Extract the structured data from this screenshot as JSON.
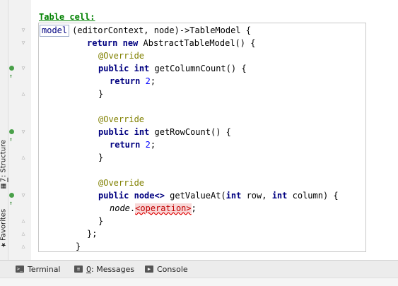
{
  "left_panels": {
    "structure": {
      "shortcut": "7",
      "label": ": Structure"
    },
    "favorites": {
      "shortcut": "",
      "label": "Favorites"
    }
  },
  "editor": {
    "section_label": "Table cell:",
    "model_keyword": "model",
    "lines": {
      "l1_rest": "(editorContext, node)->TableModel {",
      "l2_return": "return",
      "l2_new": "new",
      "l2_rest": " AbstractTableModel() {",
      "override": "@Override",
      "public": "public",
      "int": "int",
      "return": "return",
      "getColumnCount": " getColumnCount() {",
      "getRowCount": " getRowCount() {",
      "two": "2",
      "semicolon": ";",
      "close_brace": "}",
      "close_brace_semicolon": "};",
      "node_type": "node<>",
      "getValueAt_open": " getValueAt(",
      "row_param": " row, ",
      "column_param": " column) {",
      "node_var": "node",
      "dot": ".",
      "operation_ref": "<operation>",
      "close_brace_outer": "}"
    }
  },
  "bottom_tools": {
    "terminal": "Terminal",
    "messages_shortcut": "0",
    "messages": ": Messages",
    "console": "Console"
  },
  "colors": {
    "keyword": "#000080",
    "annotation": "#808000",
    "number": "#0000ff",
    "label_green": "#008000",
    "error_bg": "#f8d7d7"
  }
}
